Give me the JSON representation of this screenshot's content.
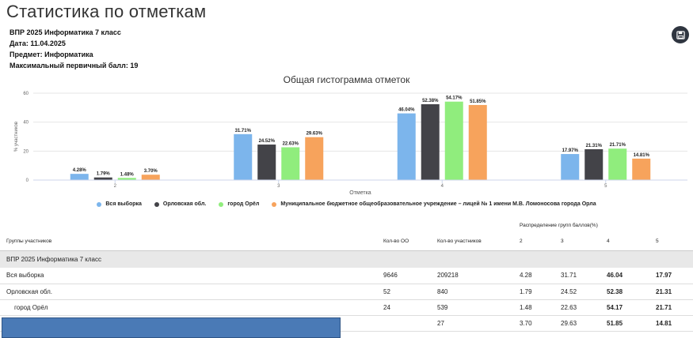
{
  "header": {
    "title": "Статистика по отметкам",
    "lines": [
      "ВПР 2025 Информатика 7 класс",
      "Дата: 11.04.2025",
      "Предмет: Информатика",
      "Максимальный первичный балл: 19"
    ]
  },
  "icons": {
    "save": "save-icon"
  },
  "colors": {
    "s1": "#7cb5ec",
    "s2": "#434348",
    "s3": "#90ed7d",
    "s4": "#f7a35c"
  },
  "chart_data": {
    "type": "bar",
    "title": "Общая гистограмма отметок",
    "xlabel": "Отметка",
    "ylabel": "% участников",
    "ylim": [
      0,
      60
    ],
    "yticks": [
      "0",
      "20",
      "40",
      "60"
    ],
    "categories": [
      "2",
      "3",
      "4",
      "5"
    ],
    "series": [
      {
        "name": "Вся выборка",
        "values": [
          4.28,
          31.71,
          46.04,
          17.97
        ],
        "labels": [
          "4.28%",
          "31.71%",
          "46.04%",
          "17.97%"
        ]
      },
      {
        "name": "Орловская обл.",
        "values": [
          1.79,
          24.52,
          52.38,
          21.31
        ],
        "labels": [
          "1.79%",
          "24.52%",
          "52.38%",
          "21.31%"
        ]
      },
      {
        "name": "город Орёл",
        "values": [
          1.48,
          22.63,
          54.17,
          21.71
        ],
        "labels": [
          "1.48%",
          "22.63%",
          "54.17%",
          "21.71%"
        ]
      },
      {
        "name": "Муниципальное бюджетное общеобразовательное учреждение – лицей № 1 имени М.В. Ломоносова города Орла",
        "values": [
          3.7,
          29.63,
          51.85,
          14.81
        ],
        "labels": [
          "3.70%",
          "29.63%",
          "51.85%",
          "14.81%"
        ]
      }
    ],
    "grid": true,
    "legend": "bottom"
  },
  "table": {
    "dist_header": "Распределение групп баллов(%)",
    "columns": [
      "Группы участников",
      "Кол-во ОО",
      "Кол-во участников",
      "2",
      "3",
      "4",
      "5"
    ],
    "group_label": "ВПР 2025 Информатика 7 класс",
    "rows": [
      {
        "name": "Вся выборка",
        "oo": "9646",
        "participants": "209218",
        "g2": "4.28",
        "g3": "31.71",
        "g4": "46.04",
        "g5": "17.97"
      },
      {
        "name": "Орловская обл.",
        "oo": "52",
        "participants": "840",
        "g2": "1.79",
        "g3": "24.52",
        "g4": "52.38",
        "g5": "21.31"
      },
      {
        "name": "город Орёл",
        "oo": "24",
        "participants": "539",
        "g2": "1.48",
        "g3": "22.63",
        "g4": "54.17",
        "g5": "21.71"
      },
      {
        "name": "",
        "oo": "",
        "participants": "27",
        "g2": "3.70",
        "g3": "29.63",
        "g4": "51.85",
        "g5": "14.81"
      }
    ]
  }
}
